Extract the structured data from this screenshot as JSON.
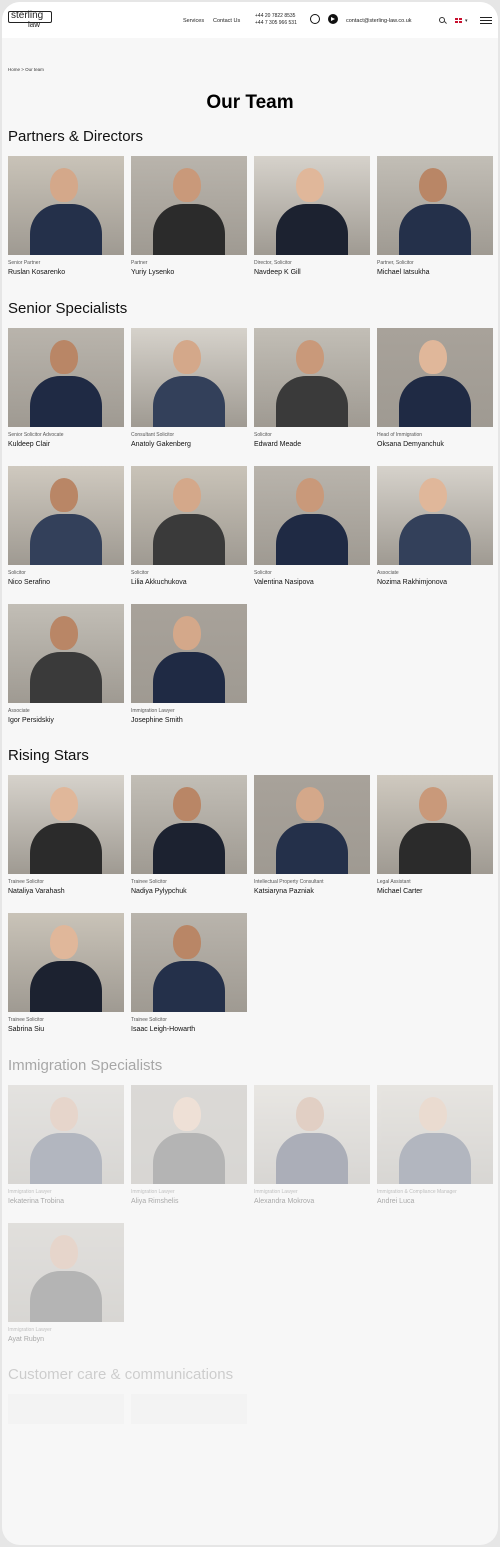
{
  "header": {
    "logo_line1": "sterling",
    "logo_line2": "law",
    "nav": [
      "Services",
      "Contact Us"
    ],
    "phone1": "+44 20 7822 8535",
    "phone2": "+44 7 305 966 531",
    "email": "contact@sterling-law.co.uk"
  },
  "breadcrumb": "Home  >  Our team",
  "page_title": "Our Team",
  "sections": [
    {
      "title": "Partners & Directors",
      "members": [
        {
          "role": "Senior Partner",
          "name": "Ruslan Kosarenko"
        },
        {
          "role": "Partner",
          "name": "Yuriy Lysenko"
        },
        {
          "role": "Director, Solicitor",
          "name": "Navdeep K Gill"
        },
        {
          "role": "Partner, Solicitor",
          "name": "Michael Iatsukha"
        }
      ]
    },
    {
      "title": "Senior Specialists",
      "members": [
        {
          "role": "Senior Solicitor Advocate",
          "name": "Kuldeep Clair"
        },
        {
          "role": "Consultant Solicitor",
          "name": "Anatoly Gakenberg"
        },
        {
          "role": "Solicitor",
          "name": "Edward Meade"
        },
        {
          "role": "Head of Immigration",
          "name": "Oksana Demyanchuk"
        },
        {
          "role": "Solicitor",
          "name": "Nico Serafino"
        },
        {
          "role": "Solicitor",
          "name": "Lilia Akkuchukova"
        },
        {
          "role": "Solicitor",
          "name": "Valentina Nasipova"
        },
        {
          "role": "Associate",
          "name": "Nozima Rakhimjonova"
        },
        {
          "role": "Associate",
          "name": "Igor Persidskiy"
        },
        {
          "role": "Immigration Lawyer",
          "name": "Josephine Smith"
        }
      ]
    },
    {
      "title": "Rising Stars",
      "members": [
        {
          "role": "Trainee Solicitor",
          "name": "Nataliya Varahash"
        },
        {
          "role": "Trainee Solicitor",
          "name": "Nadiya Pylypchuk"
        },
        {
          "role": "Intellectual Property Consultant",
          "name": "Katsiaryna Pazniak"
        },
        {
          "role": "Legal Assistant",
          "name": "Michael Carter"
        },
        {
          "role": "Trainee Solicitor",
          "name": "Sabrina Siu"
        },
        {
          "role": "Trainee Solicitor",
          "name": "Isaac Leigh-Howarth"
        }
      ]
    },
    {
      "title": "Immigration Specialists",
      "members": [
        {
          "role": "Immigration Lawyer",
          "name": "Iekaterina Trobina"
        },
        {
          "role": "Immigration Lawyer",
          "name": "Aliya Rimshelis"
        },
        {
          "role": "Immigration Lawyer",
          "name": "Alexandra Mokrova"
        },
        {
          "role": "Immigration & Compliance Manager",
          "name": "Andrei Luca"
        },
        {
          "role": "Immigration Lawyer",
          "name": "Ayat Rubyn"
        }
      ]
    },
    {
      "title": "Customer care & communications",
      "members": []
    }
  ]
}
